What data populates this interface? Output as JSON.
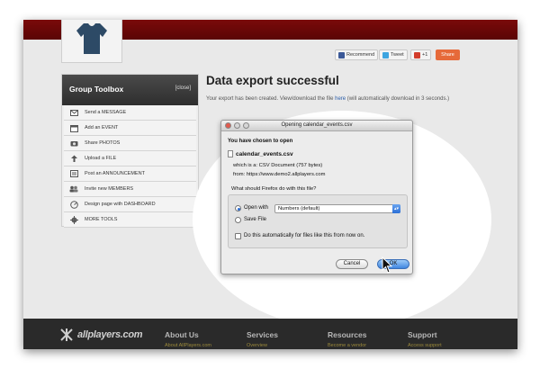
{
  "social": {
    "recommend": "Recommend",
    "tweet": "Tweet",
    "gplus": "+1",
    "share": "Share"
  },
  "toolbox": {
    "title": "Group Toolbox",
    "close": "[close]",
    "items": [
      {
        "label": "Send a MESSAGE",
        "icon": "message-icon"
      },
      {
        "label": "Add an EVENT",
        "icon": "calendar-icon"
      },
      {
        "label": "Share PHOTOS",
        "icon": "camera-icon"
      },
      {
        "label": "Upload a FILE",
        "icon": "upload-icon"
      },
      {
        "label": "Post an ANNOUNCEMENT",
        "icon": "announcement-icon"
      },
      {
        "label": "Invite new MEMBERS",
        "icon": "members-icon"
      },
      {
        "label": "Design page with DASHBOARD",
        "icon": "dashboard-icon"
      },
      {
        "label": "MORE TOOLS",
        "icon": "gear-icon"
      }
    ]
  },
  "main": {
    "title": "Data export successful",
    "msg_before": "Your export has been created. View/download the file ",
    "msg_link": "here",
    "msg_after": " (will automatically download in 3 seconds.)"
  },
  "dialog": {
    "title": "Opening calendar_events.csv",
    "chosen": "You have chosen to open",
    "filename": "calendar_events.csv",
    "which_is": "which is a:  CSV Document (757 bytes)",
    "from": "from:  https://www.demo2.allplayers.com",
    "question": "What should Firefox do with this file?",
    "open_with": "Open with",
    "open_with_app": "Numbers (default)",
    "save_file": "Save File",
    "auto": "Do this automatically for files like this from now on.",
    "cancel": "Cancel",
    "ok": "OK"
  },
  "footer": {
    "logo": "allplayers.com",
    "columns": [
      {
        "head": "About Us",
        "link": "About AllPlayers.com"
      },
      {
        "head": "Services",
        "link": "Overview"
      },
      {
        "head": "Resources",
        "link": "Become a vendor"
      },
      {
        "head": "Support",
        "link": "Access support"
      }
    ]
  },
  "colors": {
    "topbar": "#6a0808",
    "link": "#2a5da8",
    "ok_button": "#3f86e0",
    "share_button": "#e66a3a"
  }
}
